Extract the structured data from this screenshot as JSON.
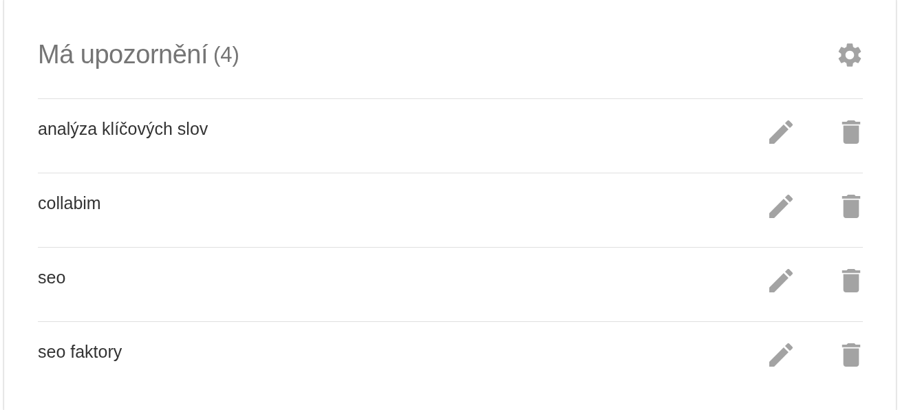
{
  "header": {
    "title": "Má upozornění",
    "count": "(4)"
  },
  "alerts": [
    {
      "name": "analýza klíčových slov"
    },
    {
      "name": "collabim"
    },
    {
      "name": "seo"
    },
    {
      "name": "seo faktory"
    }
  ]
}
